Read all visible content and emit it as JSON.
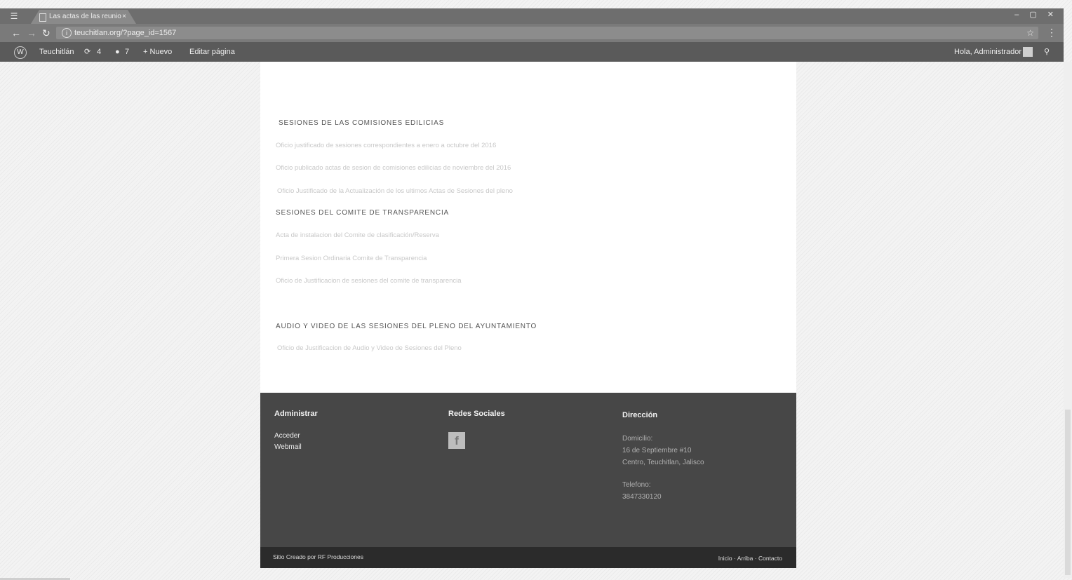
{
  "browser": {
    "tab_title": "Las actas de las reunio",
    "tab_close": "×",
    "url": "teuchitlan.org/?page_id=1567",
    "window_controls": "‒ ▢ ✕"
  },
  "admin_bar": {
    "site_name": "Teuchitlán",
    "updates": "4",
    "comments": "7",
    "new_label": "+ Nuevo",
    "edit_label": "Editar página",
    "greeting": "Hola, Administrador"
  },
  "content": {
    "section_commissions": "SESIONES DE LAS COMISIONES EDILICIAS",
    "commission_links": [
      "Oficio justificado de sesiones correspondientes a enero a octubre del 2016",
      "Oficio publicado actas de sesion de comisiones edilicias de noviembre del 2016",
      "Oficio Justificado de la Actualización de los ultimos Actas de Sesiones del pleno"
    ],
    "section_transparency": "SESIONES DEL COMITE DE TRANSPARENCIA",
    "transparency_links": [
      "Acta de instalacion del Comite de clasificación/Reserva",
      "Primera Sesion Ordinaria Comite de Transparencia",
      "Oficio de Justificacion de sesiones del comite de transparencia"
    ],
    "section_audio": "AUDIO Y VIDEO DE LAS SESIONES DEL PLENO DEL AYUNTAMIENTO",
    "audio_links": [
      "Oficio de Justificacion de Audio y Video de Sesiones del Pleno"
    ]
  },
  "footer": {
    "admin_title": "Administrar",
    "admin_links": [
      "Acceder",
      "Webmail"
    ],
    "social_title": "Redes Sociales",
    "address_title": "Dirección",
    "address_label": "Domicilio:",
    "address_line1": "16 de Septiembre #10",
    "address_line2": "Centro, Teuchitlan, Jalisco",
    "phone_label": "Telefono:",
    "phone": "3847330120",
    "credit": "Sitio Creado por RF Producciones",
    "nav": [
      "Inicio",
      "Arriba",
      "Contacto"
    ],
    "nav_separator": "·"
  }
}
